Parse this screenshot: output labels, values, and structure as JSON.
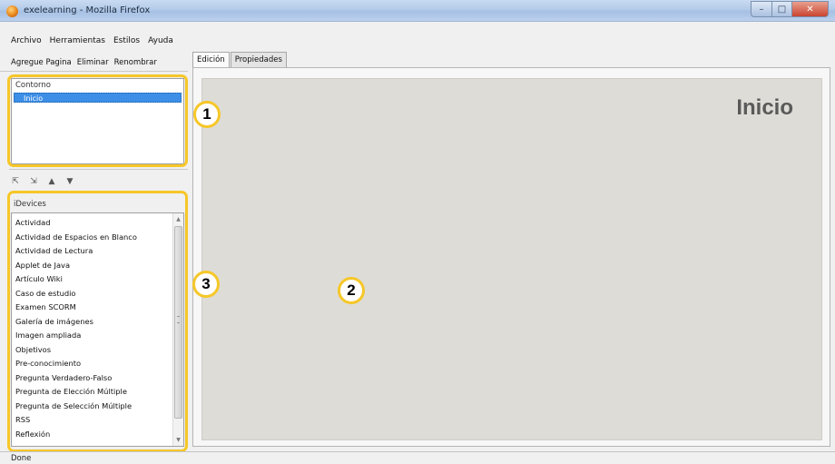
{
  "window": {
    "title": "exelearning - Mozilla Firefox",
    "controls": {
      "minimize": "–",
      "maximize": "□",
      "close": "✕"
    }
  },
  "menu": {
    "items": [
      "Archivo",
      "Herramientas",
      "Estilos",
      "Ayuda"
    ]
  },
  "toolbar": {
    "add_page": "Agregue Pagina",
    "delete": "Eliminar",
    "rename": "Renombrar"
  },
  "outline": {
    "header": "Contorno",
    "items": [
      "Inicio"
    ],
    "selected": "Inicio"
  },
  "outline_actions": [
    {
      "icon": "promote-node-icon",
      "glyph": "⇱"
    },
    {
      "icon": "demote-node-icon",
      "glyph": "⇲"
    },
    {
      "icon": "move-up-icon",
      "glyph": "▲"
    },
    {
      "icon": "move-down-icon",
      "glyph": "▼"
    }
  ],
  "idevices": {
    "header": "iDevices",
    "items": [
      "Actividad",
      "Actividad de Espacios en Blanco",
      "Actividad de Lectura",
      "Applet de Java",
      "Artículo Wiki",
      "Caso de estudio",
      "Examen SCORM",
      "Galería de imágenes",
      "Imagen ampliada",
      "Objetivos",
      "Pre-conocimiento",
      "Pregunta Verdadero-Falso",
      "Pregunta de Elección Múltiple",
      "Pregunta de Selección Múltiple",
      "RSS",
      "Reflexión"
    ],
    "scroll_fraction": 0.0
  },
  "tabs": [
    {
      "label": "Edición",
      "active": true
    },
    {
      "label": "Propiedades",
      "active": false
    }
  ],
  "content": {
    "page_title": "Inicio"
  },
  "callouts": [
    "1",
    "2",
    "3"
  ],
  "status": {
    "text": "Done"
  },
  "colors": {
    "highlight": "#f6c728",
    "selection": "#3d8ee6",
    "canvas": "#dedcd7"
  }
}
